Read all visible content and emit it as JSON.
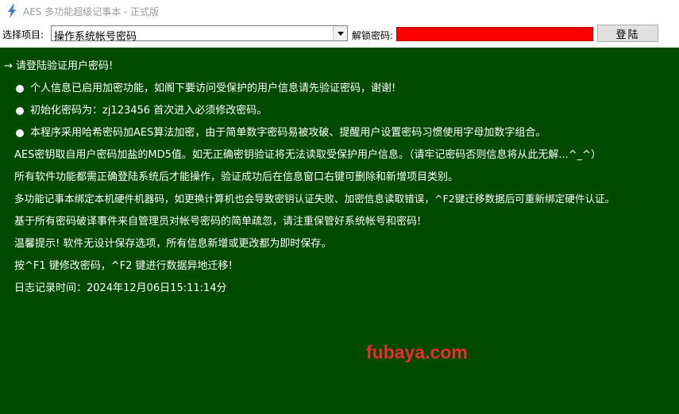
{
  "window": {
    "title": "AES 多功能超级记事本 - 正式版",
    "icon": "lightning-icon"
  },
  "toolbar": {
    "project_label": "选择项目:",
    "project_value": "操作系统帐号密码",
    "unlock_label": "解锁密码:",
    "login_label": "登陆",
    "password_field_color": "#ff0000"
  },
  "content": {
    "prompt": "→ 请登陆验证用户密码!",
    "bullets": [
      "个人信息已启用加密功能，如阁下要访问受保护的用户信息请先验证密码，谢谢!",
      "初始化密码为：zj123456 首次进入必须修改密码。",
      "本程序采用哈希密码加AES算法加密，由于简单数字密码易被攻破、提醒用户设置密码习惯使用字母加数字组合。"
    ],
    "lines": [
      "AES密钥取自用户密码加盐的MD5值。如无正确密钥验证将无法读取受保护用户信息。（请牢记密码否则信息将从此无解...^_^）",
      "所有软件功能都需正确登陆系统后才能操作，验证成功后在信息窗口右键可删除和新增项目类别。",
      "多功能记事本绑定本机硬件机器码，如更换计算机也会导致密钥认证失败、加密信息读取错误，^F2键迁移数据后可重新绑定硬件认证。",
      "基于所有密码破译事件来自管理员对帐号密码的简单疏忽，请注重保管好系统帐号和密码!",
      "温馨提示! 软件无设计保存选项，所有信息新增或更改都为即时保存。",
      "按^F1 键修改密码，^F2 键进行数据异地迁移!",
      "日志记录时间：2024年12月06日15:11:14分"
    ],
    "watermark": "fubaya.com",
    "background_color": "#004a00",
    "watermark_color": "#ee2a2a"
  }
}
